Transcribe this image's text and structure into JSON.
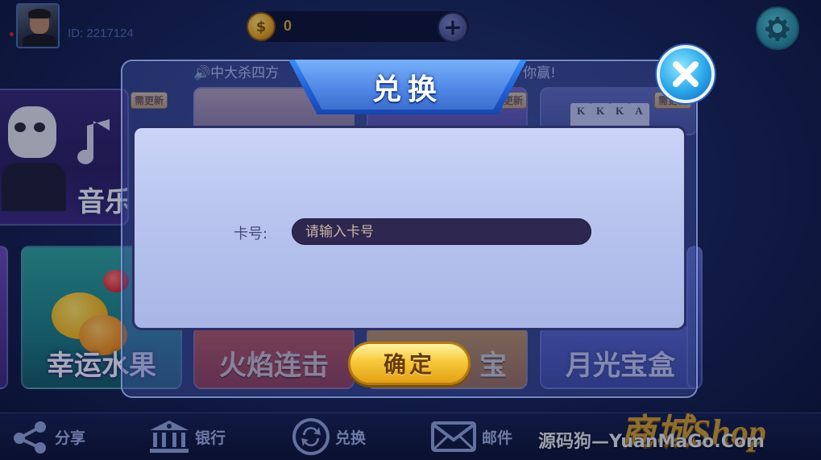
{
  "header": {
    "player_id": "ID: 2217124",
    "coin_amount": "0",
    "add_coin_symbol": "+",
    "coin_symbol": "$"
  },
  "ticker": {
    "left_text": "🔊中大杀四方",
    "right_text": "你赢!"
  },
  "games": [
    {
      "label": "音乐僵",
      "badge": ""
    },
    {
      "label": "",
      "badge": "需更新"
    },
    {
      "label": "",
      "badge": "更新"
    },
    {
      "label": "",
      "badge": "需更新"
    },
    {
      "label": "幸运水果",
      "badge": ""
    },
    {
      "label": "火焰连击",
      "badge": ""
    },
    {
      "label": "宝",
      "badge": ""
    },
    {
      "label": "月光宝盒",
      "badge": ""
    }
  ],
  "poker_cards": [
    "K",
    "K",
    "K",
    "A"
  ],
  "dialog": {
    "title": "兑换",
    "card_label": "卡号:",
    "card_placeholder": "请输入卡号",
    "card_value": "",
    "confirm_label": "确定"
  },
  "bottom_nav": [
    {
      "label": "分享",
      "icon": "share-icon"
    },
    {
      "label": "银行",
      "icon": "bank-icon"
    },
    {
      "label": "兑换",
      "icon": "exchange-icon"
    },
    {
      "label": "邮件",
      "icon": "mail-icon"
    }
  ],
  "watermark": "源码狗—YuanMaGo.Com",
  "shop_logo_text": "商城Shop",
  "colors": {
    "background": "#16245a",
    "dialog_title_blue": "#1f5fd8",
    "confirm_gold": "#f7c93a",
    "input_bg": "#2e2750",
    "close_blue": "#2aa6ea"
  }
}
